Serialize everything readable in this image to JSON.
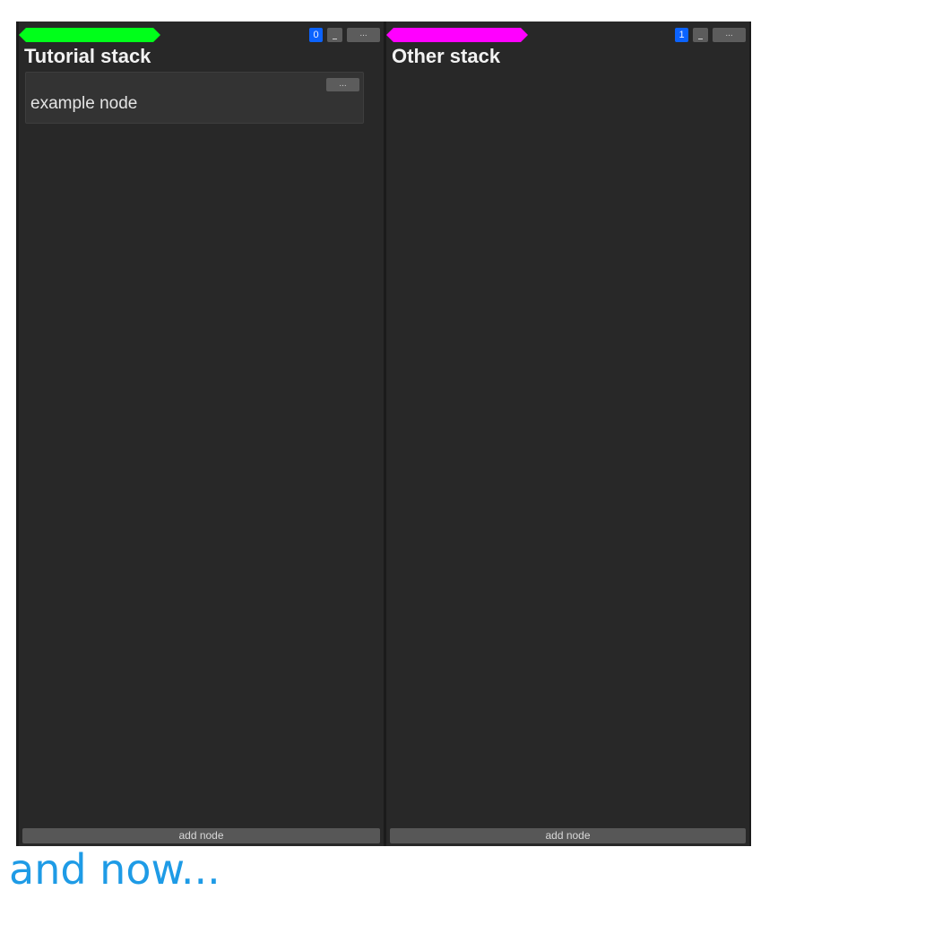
{
  "stacks": [
    {
      "title": "Tutorial stack",
      "index": "0",
      "tab_color": "#00ff1a",
      "minimize_label": "_",
      "more_label": "...",
      "add_node_label": "add node",
      "nodes": [
        {
          "label": "example node",
          "more_label": "..."
        }
      ]
    },
    {
      "title": "Other stack",
      "index": "1",
      "tab_color": "#ff00ff",
      "minimize_label": "_",
      "more_label": "...",
      "add_node_label": "add node",
      "nodes": []
    }
  ],
  "caption": "and now...",
  "colors": {
    "board_background": "#1b1b1b",
    "stack_background": "#282828",
    "node_background": "#333333",
    "button_background": "#5c5c5c",
    "badge_blue": "#0b63ff",
    "caption_blue": "#1e9be6"
  },
  "icons": {
    "minimize": "minimize-icon",
    "more": "ellipsis-icon",
    "tab": "color-tab-icon"
  }
}
